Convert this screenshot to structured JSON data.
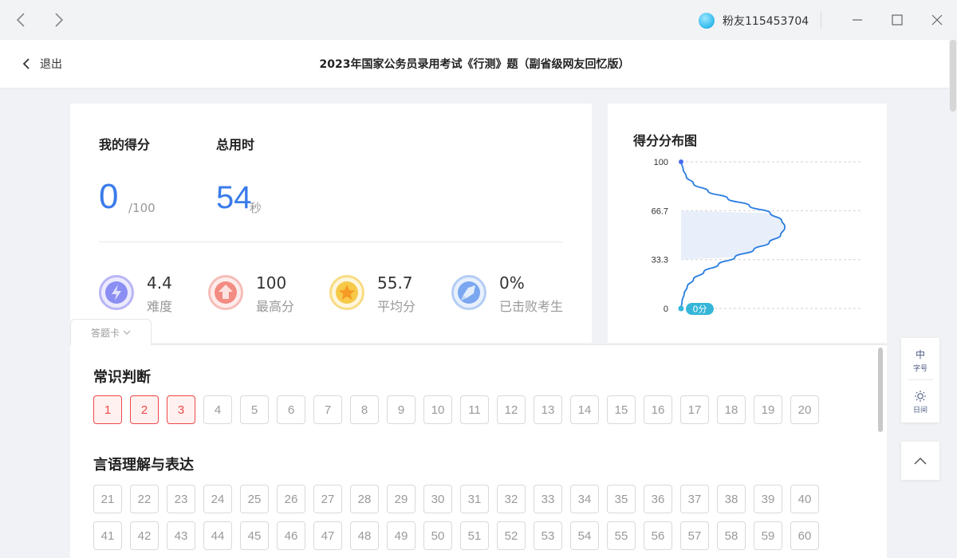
{
  "titlebar": {
    "username": "粉友115453704",
    "colors": {
      "background": "#f2f3f5",
      "avatar": "#3cc0ef"
    },
    "icons": [
      "back-arrow-icon",
      "forward-arrow-icon",
      "minimize-icon",
      "maximize-icon",
      "close-icon"
    ]
  },
  "header": {
    "back_label": "退出",
    "title": "2023年国家公务员录用考试《行测》题（副省级网友回忆版）"
  },
  "score": {
    "my_score_label": "我的得分",
    "my_score_value": "0",
    "my_score_total": "/100",
    "time_label": "总用时",
    "time_value": "54",
    "time_unit": "秒",
    "accent_color": "#3a7bea"
  },
  "stats": [
    {
      "value": "4.4",
      "label": "难度",
      "icon": "lightning-icon",
      "color": "#8b8ef2"
    },
    {
      "value": "100",
      "label": "最高分",
      "icon": "arrow-up-icon",
      "color": "#f28b82"
    },
    {
      "value": "55.7",
      "label": "平均分",
      "icon": "star-icon",
      "color": "#f7c948"
    },
    {
      "value": "0%",
      "label": "已击败考生",
      "icon": "rocket-icon",
      "color": "#7aa7f0"
    }
  ],
  "chart": {
    "title": "得分分布图",
    "marker_label": "0分"
  },
  "chart_data": {
    "type": "line",
    "title": "得分分布图",
    "orientation": "vertical-score-axis",
    "y_ticks": [
      "100",
      "66.7",
      "33.3",
      "0"
    ],
    "ylim": [
      0,
      100
    ],
    "grid": true,
    "series": [
      {
        "score": [
          0,
          5,
          10,
          15,
          20,
          25,
          30,
          35,
          40,
          45,
          50,
          55,
          56,
          60,
          65,
          70,
          75,
          80,
          85,
          90,
          95,
          100
        ],
        "density": [
          0.0,
          0.01,
          0.03,
          0.06,
          0.12,
          0.22,
          0.36,
          0.52,
          0.7,
          0.85,
          0.96,
          1.0,
          1.0,
          0.97,
          0.86,
          0.66,
          0.45,
          0.26,
          0.12,
          0.05,
          0.02,
          0.0
        ]
      }
    ],
    "highlight": {
      "score": 0,
      "label": "0分"
    },
    "colors": {
      "line": "#2a7de1",
      "fill": "#e8effa",
      "marker": "#35b6d8"
    }
  },
  "answer_card": {
    "tab_label": "答题卡",
    "sections": [
      {
        "title": "常识判断",
        "questions": [
          "1",
          "2",
          "3",
          "4",
          "5",
          "6",
          "7",
          "8",
          "9",
          "10",
          "11",
          "12",
          "13",
          "14",
          "15",
          "16",
          "17",
          "18",
          "19",
          "20"
        ],
        "wrong": [
          "1",
          "2",
          "3"
        ]
      },
      {
        "title": "言语理解与表达",
        "questions": [
          "21",
          "22",
          "23",
          "24",
          "25",
          "26",
          "27",
          "28",
          "29",
          "30",
          "31",
          "32",
          "33",
          "34",
          "35",
          "36",
          "37",
          "38",
          "39",
          "40",
          "41",
          "42",
          "43",
          "44",
          "45",
          "46",
          "47",
          "48",
          "49",
          "50",
          "51",
          "52",
          "53",
          "54",
          "55",
          "56",
          "57",
          "58",
          "59",
          "60"
        ],
        "wrong": []
      }
    ],
    "colors": {
      "wrong": "#f04848",
      "normal": "#999999"
    }
  },
  "tools": {
    "font_main": "中",
    "font_sub": "字号",
    "theme_sub": "日间",
    "icons": [
      "sun-icon",
      "chevron-up-icon"
    ]
  }
}
